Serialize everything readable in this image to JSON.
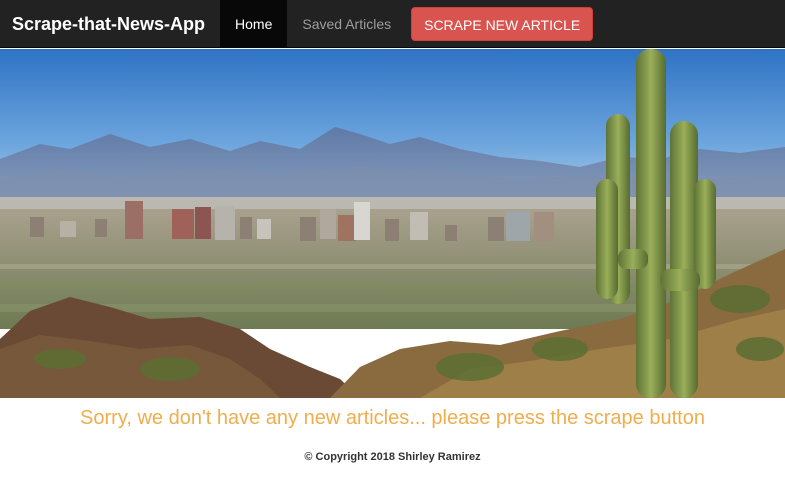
{
  "navbar": {
    "brand": "Scrape-that-News-App",
    "items": [
      {
        "label": "Home",
        "active": true
      },
      {
        "label": "Saved Articles",
        "active": false
      }
    ],
    "scrape_button": "SCRAPE NEW ARTICLE"
  },
  "hero": {
    "image": "phoenix-skyline-with-saguaro-cactus-and-mountains"
  },
  "main": {
    "message": "Sorry, we don't have any new articles... please press the scrape button"
  },
  "footer": {
    "copyright": "© Copyright 2018 Shirley Ramirez"
  },
  "colors": {
    "navbar_bg": "#222222",
    "active_tab_bg": "#080808",
    "scrape_button": "#d9534f",
    "message_text": "#f0ad4e"
  }
}
